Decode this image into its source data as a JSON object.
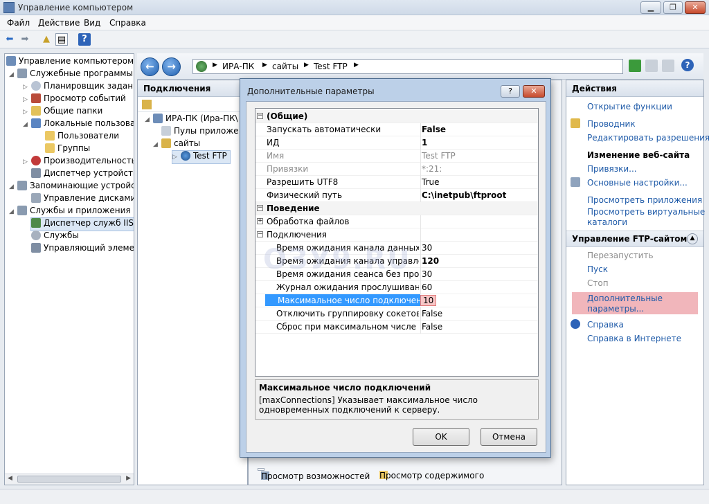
{
  "window": {
    "title": "Управление компьютером"
  },
  "menu": [
    "Файл",
    "Действие",
    "Вид",
    "Справка"
  ],
  "tree": [
    "Управление компьютером (л",
    "Служебные программы",
    "Планировщик заданий",
    "Просмотр событий",
    "Общие папки",
    "Локальные пользовате",
    "Пользователи",
    "Группы",
    "Производительность",
    "Диспетчер устройств",
    "Запоминающие устройст",
    "Управление дисками",
    "Службы и приложения",
    "Диспетчер служб IIS",
    "Службы",
    "Управляющий элемен"
  ],
  "address": {
    "parts": [
      "ИРА-ПК",
      "сайты",
      "Test FTP"
    ]
  },
  "connections": {
    "header": "Подключения",
    "items": [
      "ИРА-ПК (Ира-ПК\\",
      "Пулы приложе",
      "сайты",
      "Test FTP"
    ]
  },
  "view_tabs": {
    "features": "Просмотр возможностей",
    "content": "Просмотр содержимого"
  },
  "actions": {
    "header": "Действия",
    "open_feature": "Открытие функции",
    "explorer": "Проводник",
    "edit_permissions": "Редактировать разрешения...",
    "edit_site": "Изменение веб-сайта",
    "bindings": "Привязки...",
    "basic_settings": "Основные настройки...",
    "view_apps": "Просмотреть приложения",
    "view_vdirs": "Просмотреть виртуальные",
    "view_vdirs2": "каталоги",
    "ftp_manage": "Управление FTP-сайтом",
    "restart": "Перезапустить",
    "start": "Пуск",
    "stop": "Стоп",
    "advanced": "Дополнительные",
    "advanced2": "параметры...",
    "help": "Справка",
    "help_online": "Справка в Интернете"
  },
  "dialog": {
    "title": "Дополнительные параметры",
    "help_btn": "?",
    "close_btn": "✕",
    "rows": [
      {
        "name": "(Общие)",
        "value": ""
      },
      {
        "name": "Запускать автоматически",
        "value": "False"
      },
      {
        "name": "ИД",
        "value": "1"
      },
      {
        "name": "Имя",
        "value": "Test FTP"
      },
      {
        "name": "Привязки",
        "value": "*:21:"
      },
      {
        "name": "Разрешить UTF8",
        "value": "True"
      },
      {
        "name": "Физический путь",
        "value": "C:\\inetpub\\ftproot"
      },
      {
        "name": "Поведение",
        "value": ""
      },
      {
        "name": "Обработка файлов",
        "value": ""
      },
      {
        "name": "Подключения",
        "value": ""
      },
      {
        "name": "Время ожидания канала данных",
        "value": "30"
      },
      {
        "name": "Время ожидания канала управления",
        "value": "120"
      },
      {
        "name": "Время ожидания сеанса без проверки",
        "value": "30"
      },
      {
        "name": "Журнал ожидания прослушивания с",
        "value": "60"
      },
      {
        "name": "Максимальное число подключений",
        "value": "10"
      },
      {
        "name": "Отключить группировку сокетов",
        "value": "False"
      },
      {
        "name": "Сброс при максимальном числе под",
        "value": "False"
      }
    ],
    "desc_title": "Максимальное число подключений",
    "desc_text": "[maxConnections] Указывает максимальное число одновременных подключений к серверу.",
    "ok": "OK",
    "cancel": "Отмена"
  },
  "watermark": "ОЗУ9.RU"
}
